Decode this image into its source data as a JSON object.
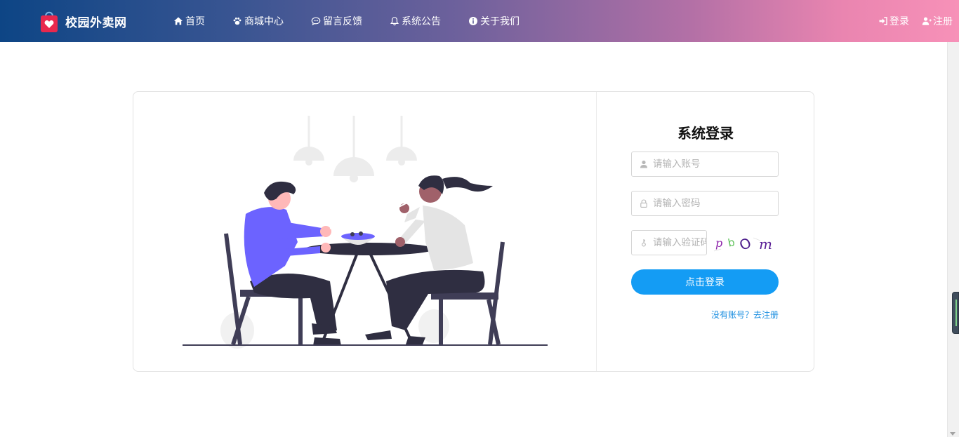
{
  "brand": {
    "title": "校园外卖网"
  },
  "nav": [
    {
      "label": "首页",
      "icon": "home-icon"
    },
    {
      "label": "商城中心",
      "icon": "paw-icon"
    },
    {
      "label": "留言反馈",
      "icon": "comment-icon"
    },
    {
      "label": "系统公告",
      "icon": "bell-icon"
    },
    {
      "label": "关于我们",
      "icon": "info-icon"
    }
  ],
  "auth": {
    "login_label": "登录",
    "register_label": "注册"
  },
  "login_form": {
    "title": "系统登录",
    "username_placeholder": "请输入账号",
    "password_placeholder": "请输入密码",
    "captcha_placeholder": "请输入验证码",
    "captcha_chars": [
      "p",
      "b",
      "O",
      "m"
    ],
    "submit_label": "点击登录",
    "register_link": "没有账号？去注册"
  },
  "colors": {
    "header_gradient": [
      "#0d4585",
      "#6e619c",
      "#f791b8"
    ],
    "primary_button": "#149cf4",
    "link": "#1a8ee0"
  }
}
